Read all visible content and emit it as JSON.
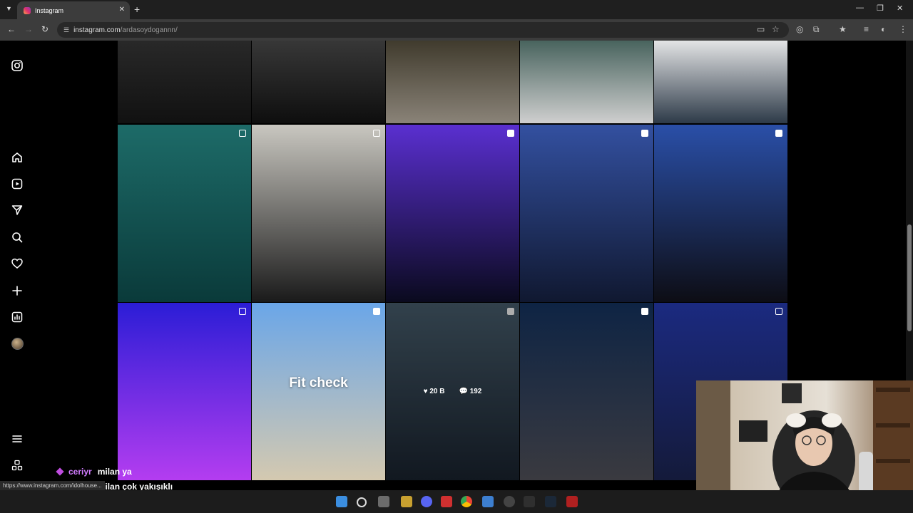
{
  "browser": {
    "tab_title": "Instagram",
    "url_host": "instagram.com",
    "url_path": "/ardasoydogannn/",
    "status_url": "https://www.instagram.com/idolhouse..."
  },
  "sidebar": {
    "icons": [
      "instagram-logo-icon",
      "home-icon",
      "reels-icon",
      "direct-messages-icon",
      "search-icon",
      "notifications-heart-icon",
      "create-plus-icon",
      "insights-chart-icon",
      "profile-avatar",
      "more-menu-icon",
      "also-from-meta-icon"
    ]
  },
  "grid": {
    "tiles": [
      {
        "id": "r0c0",
        "type": "photo",
        "top_color": "#2a2a2a",
        "bottom_color": "#111111"
      },
      {
        "id": "r0c1",
        "type": "photo",
        "top_color": "#3a3a3a",
        "bottom_color": "#0e0e0e"
      },
      {
        "id": "r0c2",
        "type": "photo",
        "top_color": "#3b3628",
        "bottom_color": "#8a8378"
      },
      {
        "id": "r0c3",
        "type": "photo",
        "top_color": "#3f5c56",
        "bottom_color": "#cfcfcf"
      },
      {
        "id": "r0c4",
        "type": "photo",
        "top_color": "#f0f0f0",
        "bottom_color": "#2d3a48"
      },
      {
        "id": "r1c0",
        "type": "carousel",
        "top_color": "#1d6b68",
        "bottom_color": "#0a3a3a"
      },
      {
        "id": "r1c1",
        "type": "carousel",
        "top_color": "#c9c7c0",
        "bottom_color": "#1a1a1a"
      },
      {
        "id": "r1c2",
        "type": "reel",
        "top_color": "#5a2fd0",
        "bottom_color": "#0a0a1e"
      },
      {
        "id": "r1c3",
        "type": "reel",
        "top_color": "#3350a0",
        "bottom_color": "#101830"
      },
      {
        "id": "r1c4",
        "type": "reel",
        "top_color": "#2a4fa8",
        "bottom_color": "#0d0d14"
      },
      {
        "id": "r2c0",
        "type": "carousel",
        "top_color": "#2b1dd6",
        "bottom_color": "#b43df0"
      },
      {
        "id": "r2c1",
        "type": "reel",
        "top_color": "#6aa6e8",
        "bottom_color": "#d4c9b0"
      },
      {
        "id": "r2c2",
        "type": "reel",
        "top_color": "#4a6070",
        "bottom_color": "#1a2430"
      },
      {
        "id": "r2c3",
        "type": "reel",
        "top_color": "#0e2444",
        "bottom_color": "#3a3a40"
      },
      {
        "id": "r2c4",
        "type": "carousel",
        "top_color": "#1b2a80",
        "bottom_color": "#141a3a"
      }
    ],
    "fit_check_text": "Fit check",
    "hover": {
      "likes": "20 B",
      "comments": "192"
    }
  },
  "chat": [
    {
      "user": "ceriyr",
      "message": "milan ya"
    },
    {
      "user": "ceriyr",
      "message": "milan çok yakışıklı"
    },
    {
      "user": "ceriyr",
      "message": ""
    }
  ],
  "colors": {
    "chrome_bg": "#3c3c3c",
    "tab_strip": "#1f1f1f",
    "chat_user": "#d27cff",
    "taskbar": "#1c1c1c"
  }
}
